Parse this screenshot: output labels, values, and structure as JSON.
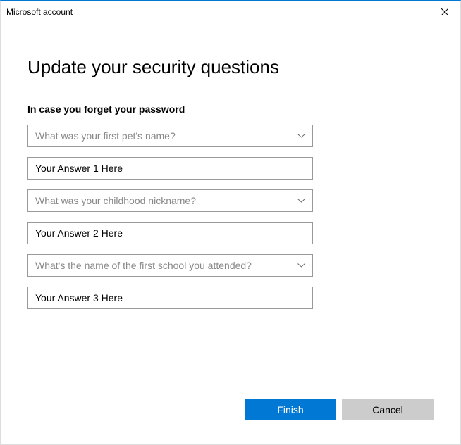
{
  "window": {
    "title": "Microsoft account"
  },
  "page": {
    "heading": "Update your security questions",
    "subheading": "In case you forget your password"
  },
  "questions": [
    {
      "selected": "What was your first pet's name?",
      "answer": "Your Answer 1 Here"
    },
    {
      "selected": "What was your childhood nickname?",
      "answer": "Your Answer 2 Here"
    },
    {
      "selected": "What's the name of the first school you attended?",
      "answer": "Your Answer 3 Here"
    }
  ],
  "buttons": {
    "finish": "Finish",
    "cancel": "Cancel"
  }
}
